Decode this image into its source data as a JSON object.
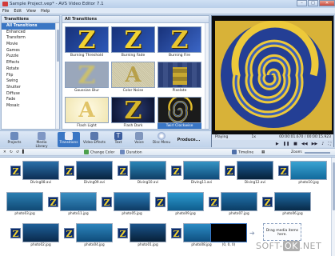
{
  "window": {
    "title": "Sample Project.vep* - AVS Video Editor 7.1",
    "minimize": "–",
    "maximize": "□",
    "close": "✕"
  },
  "menu": [
    "File",
    "Edit",
    "View",
    "Help"
  ],
  "transitions_panel": {
    "header": "Transitions",
    "categories": [
      "All Transitions",
      "Enhanced",
      "Transform",
      "Movie",
      "Games",
      "Puzzle",
      "Effects",
      "Rotate",
      "Flip",
      "Swing",
      "Shutter",
      "Diffuse",
      "Fade",
      "Mosaic"
    ],
    "selected": "All Transitions"
  },
  "transitions_grid": {
    "header": "All Transitions",
    "items": [
      {
        "label": "Burning Threshold",
        "selected": false
      },
      {
        "label": "Burning Fade",
        "selected": false
      },
      {
        "label": "Burning Fire",
        "selected": false
      },
      {
        "label": "Gaussian Blur",
        "selected": false
      },
      {
        "label": "Color Noise",
        "selected": false
      },
      {
        "label": "Pixelate",
        "selected": false
      },
      {
        "label": "Flash Light",
        "selected": false
      },
      {
        "label": "Flash Dark",
        "selected": false
      },
      {
        "label": "Twirl Clockwise",
        "selected": true
      }
    ]
  },
  "preview": {
    "state": "Playing",
    "speed": "1x",
    "time": "00:00:01.670 / 00:00:15.923"
  },
  "toolbar": {
    "buttons": [
      "Projects",
      "Media Library",
      "Transitions",
      "Video Effects",
      "Text",
      "Voice",
      "Disc Menu",
      "Produce..."
    ],
    "selected": "Transitions"
  },
  "subbar": {
    "change_color": "Change Color",
    "duration": "Duration",
    "timeline": "Timeline",
    "zoom": "Zoom:"
  },
  "media": {
    "row1": [
      "Diving08.avi",
      "Diving09.avi",
      "Diving10.avi",
      "Diving11.avi",
      "Diving12.avi",
      "photo10.jpg"
    ],
    "row2": [
      "photo03.jpg",
      "photo11.jpg",
      "photo05.jpg",
      "photo09.jpg",
      "photo07.jpg",
      "photo06.jpg"
    ],
    "row3": [
      "photo02.jpg",
      "photo04.jpg",
      "photo01.jpg",
      "photo08.jpg",
      "(0, 0, 0)"
    ],
    "drag_text": "Drag media items here."
  },
  "watermark": {
    "prefix": "SOFT-",
    "ok": "OK",
    "suffix": ".NET"
  },
  "colors": {
    "accent": "#3a76c4",
    "title_bg": "#c7d7ea",
    "z_gold": "#f2d331"
  }
}
